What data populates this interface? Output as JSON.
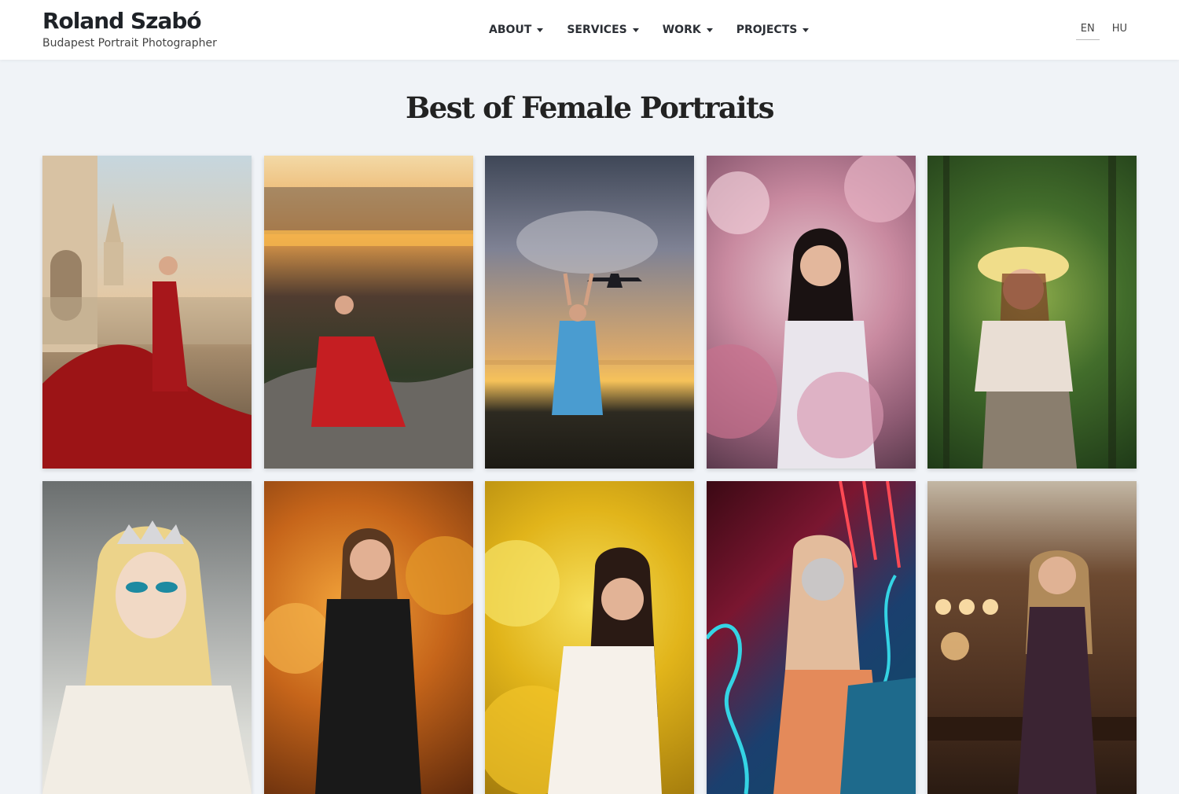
{
  "brand": {
    "name": "Roland Szabó",
    "tagline": "Budapest Portrait Photographer"
  },
  "nav": {
    "items": [
      {
        "label": "ABOUT"
      },
      {
        "label": "SERVICES"
      },
      {
        "label": "WORK"
      },
      {
        "label": "PROJECTS"
      }
    ],
    "dropdown_icon": "caret-down-icon"
  },
  "language": {
    "options": [
      "EN",
      "HU"
    ],
    "selected": "EN"
  },
  "page": {
    "title": "Best of Female Portraits"
  },
  "gallery": {
    "photos": [
      {
        "id": "photo-1",
        "scene": "red-gown-fishermans-bastion",
        "dominant_color": "#b01a1d"
      },
      {
        "id": "photo-2",
        "scene": "red-dress-hilltop-sunset",
        "dominant_color": "#c42024"
      },
      {
        "id": "photo-3",
        "scene": "blue-dress-airplane-sunset",
        "dominant_color": "#3d7fb7"
      },
      {
        "id": "photo-4",
        "scene": "magnolia-blossoms",
        "dominant_color": "#d8a0b4"
      },
      {
        "id": "photo-5",
        "scene": "straw-hat-forest",
        "dominant_color": "#3e6b2a"
      },
      {
        "id": "photo-6",
        "scene": "winter-crown-makeup",
        "dominant_color": "#cfd3d4"
      },
      {
        "id": "photo-7",
        "scene": "autumn-leaves-black-jacket",
        "dominant_color": "#e08a24"
      },
      {
        "id": "photo-8",
        "scene": "yellow-blossoms-white-top",
        "dominant_color": "#e6b51c"
      },
      {
        "id": "photo-9",
        "scene": "neon-lights",
        "dominant_color": "#2b9ec7"
      },
      {
        "id": "photo-10",
        "scene": "vintage-cafe-interior",
        "dominant_color": "#5a3a25"
      }
    ]
  }
}
